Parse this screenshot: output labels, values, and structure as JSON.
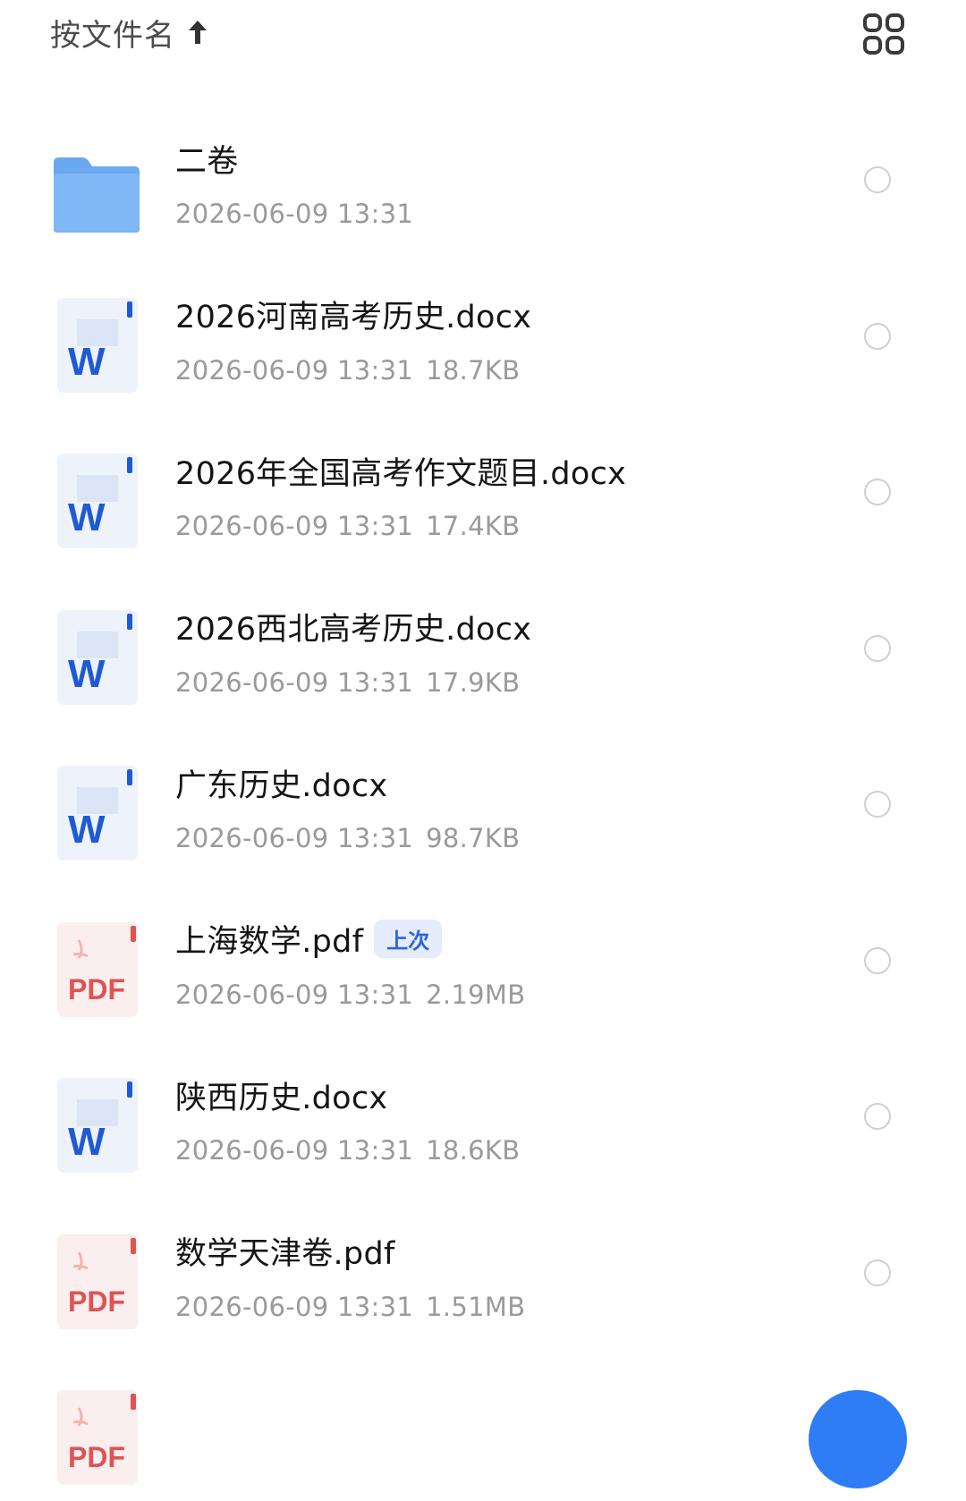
{
  "header": {
    "sort_label": "按文件名",
    "sort_direction_icon": "arrow-up-icon",
    "view_toggle_icon": "grid-view-icon"
  },
  "colors": {
    "folder": "#7fb6f4",
    "word_blue": "#1f5ad6",
    "pdf_red": "#e05353",
    "badge_bg": "#e4ecfd",
    "badge_text": "#2f63d8",
    "accent_fab": "#2e7cf6"
  },
  "files": [
    {
      "type": "folder",
      "icon": "folder-icon",
      "name": "二卷",
      "date": "2026-06-09 13:31",
      "size": ""
    },
    {
      "type": "docx",
      "icon": "word-document-icon",
      "icon_letter": "W",
      "name": "2026河南高考历史.docx",
      "date": "2026-06-09 13:31",
      "size": "18.7KB"
    },
    {
      "type": "docx",
      "icon": "word-document-icon",
      "icon_letter": "W",
      "name": "2026年全国高考作文题目.docx",
      "date": "2026-06-09 13:31",
      "size": "17.4KB"
    },
    {
      "type": "docx",
      "icon": "word-document-icon",
      "icon_letter": "W",
      "name": "2026西北高考历史.docx",
      "date": "2026-06-09 13:31",
      "size": "17.9KB"
    },
    {
      "type": "docx",
      "icon": "word-document-icon",
      "icon_letter": "W",
      "name": "广东历史.docx",
      "date": "2026-06-09 13:31",
      "size": "98.7KB"
    },
    {
      "type": "pdf",
      "icon": "pdf-document-icon",
      "icon_label": "PDF",
      "name": "上海数学.pdf",
      "badge": "上次",
      "date": "2026-06-09 13:31",
      "size": "2.19MB"
    },
    {
      "type": "docx",
      "icon": "word-document-icon",
      "icon_letter": "W",
      "name": "陕西历史.docx",
      "date": "2026-06-09 13:31",
      "size": "18.6KB"
    },
    {
      "type": "pdf",
      "icon": "pdf-document-icon",
      "icon_label": "PDF",
      "name": "数学天津卷.pdf",
      "date": "2026-06-09 13:31",
      "size": "1.51MB"
    },
    {
      "type": "pdf",
      "icon": "pdf-document-icon",
      "icon_label": "PDF",
      "name": "",
      "date": "",
      "size": ""
    }
  ],
  "fab": {
    "icon": "add-icon"
  }
}
